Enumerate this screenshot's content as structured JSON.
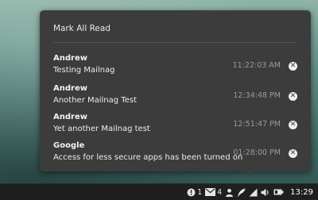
{
  "popup": {
    "mark_all_label": "Mark All Read",
    "notifications": [
      {
        "sender": "Andrew",
        "message": "Testing Mailnag",
        "time": "11:22:03 AM"
      },
      {
        "sender": "Andrew",
        "message": "Another Mailnag Test",
        "time": "12:34:48 PM"
      },
      {
        "sender": "Andrew",
        "message": "Yet another Mailnag test",
        "time": "12:51:47 PM"
      },
      {
        "sender": "Google",
        "message": "Access for less secure apps has been turned on",
        "time": "01:28:00 PM"
      }
    ],
    "dismiss_glyph": "✕"
  },
  "tray": {
    "alert_count": "1",
    "mail_count": "4",
    "clock": "13:29",
    "icons": [
      "alert-icon",
      "mail-icon",
      "user-icon",
      "feather-icon",
      "network-icon",
      "volume-icon",
      "battery-icon"
    ]
  },
  "colors": {
    "popup_bg": "#3c3c3c",
    "taskbar_bg": "#1f1f1f",
    "time_text": "#9a9a9a"
  }
}
